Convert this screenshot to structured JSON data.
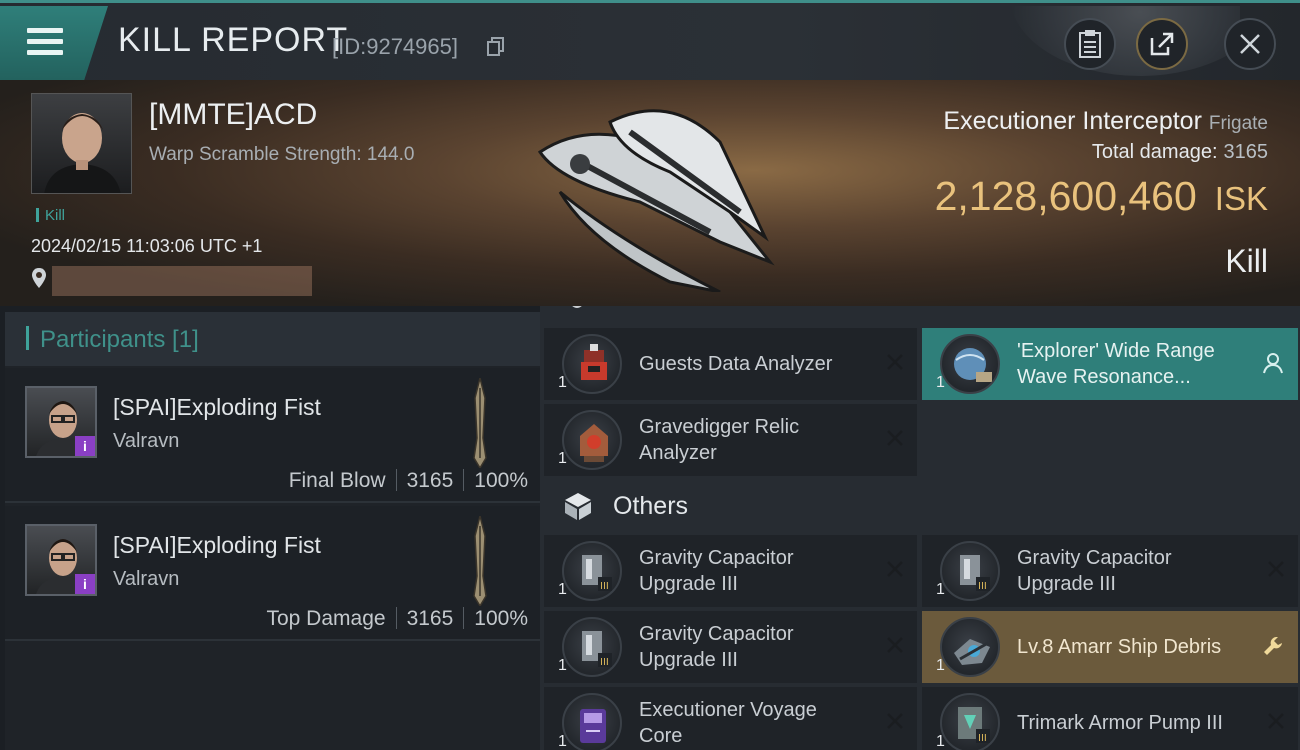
{
  "header": {
    "title": "KILL REPORT",
    "report_id": "[ID:9274965]"
  },
  "victim": {
    "name": "[MMTE]ACD",
    "warp_scramble": "Warp Scramble Strength: 144.0",
    "tag": "Kill",
    "datetime": "2024/02/15 11:03:06 UTC +1",
    "ship_name": "Executioner Interceptor",
    "ship_class": "Frigate",
    "total_damage_label": "Total damage:",
    "total_damage": "3165",
    "isk_value": "2,128,600,460",
    "isk_unit": "ISK",
    "result": "Kill"
  },
  "participants": {
    "title": "Participants [1]",
    "list": [
      {
        "name": "[SPAI]Exploding Fist",
        "corp": "Valravn",
        "role": "Final Blow",
        "damage": "3165",
        "percent": "100%"
      },
      {
        "name": "[SPAI]Exploding Fist",
        "corp": "Valravn",
        "role": "Top Damage",
        "damage": "3165",
        "percent": "100%"
      }
    ]
  },
  "items": {
    "top": [
      {
        "name": "Guests Data Analyzer",
        "qty": "1",
        "icon": "data-analyzer-icon",
        "state": "normal"
      },
      {
        "name": "'Explorer' Wide Range Wave Resonance...",
        "qty": "1",
        "icon": "scanner-probe-icon",
        "state": "fitted"
      },
      {
        "name": "Gravedigger Relic Analyzer",
        "qty": "1",
        "icon": "relic-analyzer-icon",
        "state": "normal"
      }
    ],
    "others_title": "Others",
    "others": [
      {
        "name": "Gravity Capacitor Upgrade III",
        "qty": "1",
        "icon": "rig-icon",
        "state": "normal"
      },
      {
        "name": "Gravity Capacitor Upgrade III",
        "qty": "1",
        "icon": "rig-icon",
        "state": "normal"
      },
      {
        "name": "Gravity Capacitor Upgrade III",
        "qty": "1",
        "icon": "rig-icon",
        "state": "normal"
      },
      {
        "name": "Lv.8 Amarr Ship Debris",
        "qty": "1",
        "icon": "debris-icon",
        "state": "salvage"
      },
      {
        "name": "Executioner Voyage Core",
        "qty": "1",
        "icon": "voyage-core-icon",
        "state": "normal"
      },
      {
        "name": "Trimark Armor Pump III",
        "qty": "1",
        "icon": "armor-rig-icon",
        "state": "normal"
      }
    ]
  },
  "colors": {
    "accent_teal": "#2f7f7a",
    "isk_gold": "#e9c27d",
    "salvage_gold": "#6b5a3c",
    "badge_purple": "#8a3fc4"
  }
}
